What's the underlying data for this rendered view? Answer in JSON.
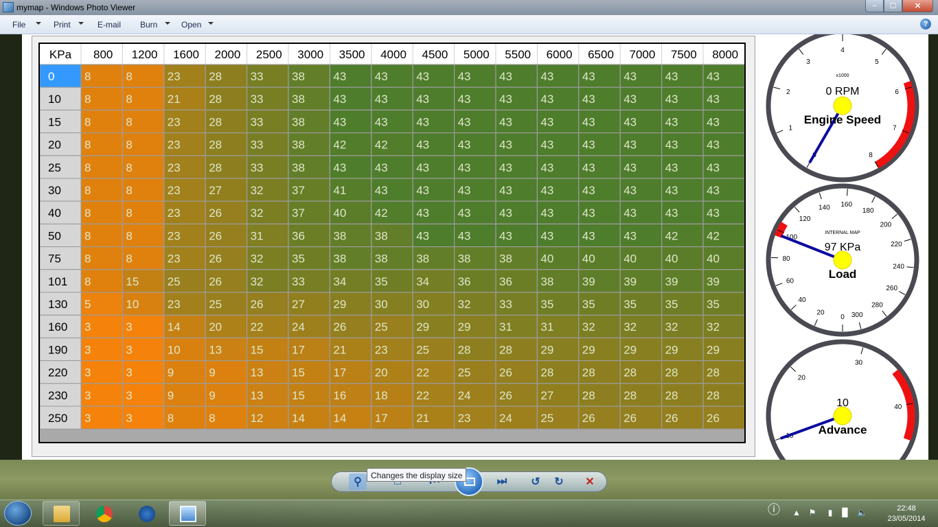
{
  "window": {
    "title": "mymap - Windows Photo Viewer",
    "min": "−",
    "max": "☐",
    "close": "✕"
  },
  "menu": {
    "file": "File",
    "print": "Print",
    "email": "E-mail",
    "burn": "Burn",
    "open": "Open",
    "help": "?"
  },
  "table": {
    "corner": "KPa",
    "rpm": [
      "800",
      "1200",
      "1600",
      "2000",
      "2500",
      "3000",
      "3500",
      "4000",
      "4500",
      "5000",
      "5500",
      "6000",
      "6500",
      "7000",
      "7500",
      "8000"
    ],
    "kpa": [
      "0",
      "10",
      "15",
      "20",
      "25",
      "30",
      "40",
      "50",
      "75",
      "101",
      "130",
      "160",
      "190",
      "220",
      "230",
      "250"
    ],
    "values": [
      [
        "8",
        "8",
        "23",
        "28",
        "33",
        "38",
        "43",
        "43",
        "43",
        "43",
        "43",
        "43",
        "43",
        "43",
        "43",
        "43"
      ],
      [
        "8",
        "8",
        "21",
        "28",
        "33",
        "38",
        "43",
        "43",
        "43",
        "43",
        "43",
        "43",
        "43",
        "43",
        "43",
        "43"
      ],
      [
        "8",
        "8",
        "23",
        "28",
        "33",
        "38",
        "43",
        "43",
        "43",
        "43",
        "43",
        "43",
        "43",
        "43",
        "43",
        "43"
      ],
      [
        "8",
        "8",
        "23",
        "28",
        "33",
        "38",
        "42",
        "42",
        "43",
        "43",
        "43",
        "43",
        "43",
        "43",
        "43",
        "43"
      ],
      [
        "8",
        "8",
        "23",
        "28",
        "33",
        "38",
        "43",
        "43",
        "43",
        "43",
        "43",
        "43",
        "43",
        "43",
        "43",
        "43"
      ],
      [
        "8",
        "8",
        "23",
        "27",
        "32",
        "37",
        "41",
        "43",
        "43",
        "43",
        "43",
        "43",
        "43",
        "43",
        "43",
        "43"
      ],
      [
        "8",
        "8",
        "23",
        "26",
        "32",
        "37",
        "40",
        "42",
        "43",
        "43",
        "43",
        "43",
        "43",
        "43",
        "43",
        "43"
      ],
      [
        "8",
        "8",
        "23",
        "26",
        "31",
        "36",
        "38",
        "38",
        "43",
        "43",
        "43",
        "43",
        "43",
        "43",
        "42",
        "42"
      ],
      [
        "8",
        "8",
        "23",
        "26",
        "32",
        "35",
        "38",
        "38",
        "38",
        "38",
        "38",
        "40",
        "40",
        "40",
        "40",
        "40"
      ],
      [
        "8",
        "15",
        "25",
        "26",
        "32",
        "33",
        "34",
        "35",
        "34",
        "36",
        "36",
        "38",
        "39",
        "39",
        "39",
        "39"
      ],
      [
        "5",
        "10",
        "23",
        "25",
        "26",
        "27",
        "29",
        "30",
        "30",
        "32",
        "33",
        "35",
        "35",
        "35",
        "35",
        "35"
      ],
      [
        "3",
        "3",
        "14",
        "20",
        "22",
        "24",
        "26",
        "25",
        "29",
        "29",
        "31",
        "31",
        "32",
        "32",
        "32",
        "32"
      ],
      [
        "3",
        "3",
        "10",
        "13",
        "15",
        "17",
        "21",
        "23",
        "25",
        "28",
        "28",
        "29",
        "29",
        "29",
        "29",
        "29"
      ],
      [
        "3",
        "3",
        "9",
        "9",
        "13",
        "15",
        "17",
        "20",
        "22",
        "25",
        "26",
        "28",
        "28",
        "28",
        "28",
        "28"
      ],
      [
        "3",
        "3",
        "9",
        "9",
        "13",
        "15",
        "16",
        "18",
        "22",
        "24",
        "26",
        "27",
        "28",
        "28",
        "28",
        "28"
      ],
      [
        "3",
        "3",
        "8",
        "8",
        "12",
        "14",
        "14",
        "17",
        "21",
        "23",
        "24",
        "25",
        "26",
        "26",
        "26",
        "26"
      ]
    ],
    "selected_row": 0,
    "colors": {
      "low": "#f5820a",
      "high": "#4e7d2c",
      "text": "#dfe6c8",
      "selected": "#3399ff"
    }
  },
  "gauges": {
    "rpm": {
      "ticks": [
        "0",
        "1",
        "2",
        "3",
        "4",
        "5",
        "6",
        "7",
        "8"
      ],
      "multiplier": "x1000",
      "value_text": "0 RPM",
      "label": "Engine Speed",
      "value": 0
    },
    "load": {
      "ticks": [
        "0",
        "20",
        "40",
        "60",
        "80",
        "100",
        "120",
        "140",
        "160",
        "180",
        "200",
        "220",
        "240",
        "260",
        "280",
        "300"
      ],
      "sublabel": "INTERNAL MAP",
      "value_text": "97 KPa",
      "label": "Load",
      "value": 97
    },
    "advance": {
      "ticks": [
        "10",
        "20",
        "30",
        "40"
      ],
      "value_text": "10",
      "label": "Advance",
      "value": 10
    }
  },
  "viewer_toolbar": {
    "tooltip": "Changes the display size"
  },
  "taskbar": {
    "time": "22:48",
    "date": "23/05/2014"
  }
}
